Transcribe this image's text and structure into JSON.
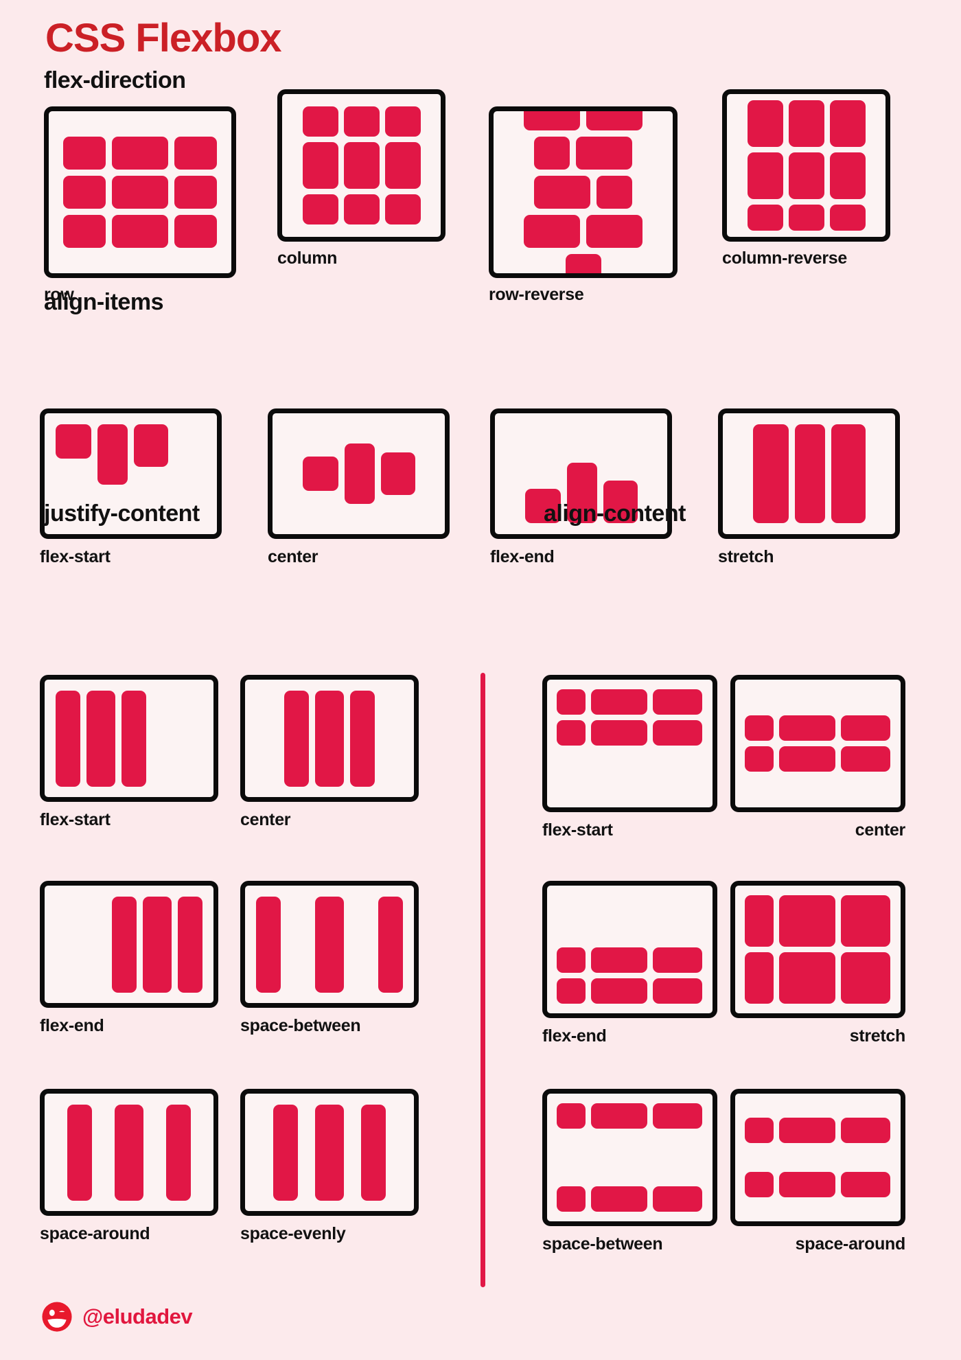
{
  "title": "CSS Flexbox",
  "colors": {
    "background": "#FCEAEC",
    "title_red": "#CB2026",
    "item_red": "#E11746",
    "box_fill": "#FCF3F3",
    "box_border": "#0B0B0B",
    "handle_red": "#E1173E"
  },
  "sections": {
    "flex_direction": {
      "heading": "flex-direction",
      "demos": [
        {
          "label": "row"
        },
        {
          "label": "column"
        },
        {
          "label": "row-reverse"
        },
        {
          "label": "column-reverse"
        }
      ]
    },
    "align_items": {
      "heading": "align-items",
      "demos": [
        {
          "label": "flex-start"
        },
        {
          "label": "center"
        },
        {
          "label": "flex-end"
        },
        {
          "label": "stretch"
        }
      ]
    },
    "justify_content": {
      "heading": "justify-content",
      "demos": [
        {
          "label": "flex-start"
        },
        {
          "label": "center"
        },
        {
          "label": "flex-end"
        },
        {
          "label": "space-between"
        },
        {
          "label": "space-around"
        },
        {
          "label": "space-evenly"
        }
      ]
    },
    "align_content": {
      "heading": "align-content",
      "demos": [
        {
          "label": "flex-start"
        },
        {
          "label": "center"
        },
        {
          "label": "flex-end"
        },
        {
          "label": "stretch"
        },
        {
          "label": "space-between"
        },
        {
          "label": "space-around"
        }
      ]
    }
  },
  "footer": {
    "icon": "winking-smiley-icon",
    "handle": "@eludadev"
  }
}
